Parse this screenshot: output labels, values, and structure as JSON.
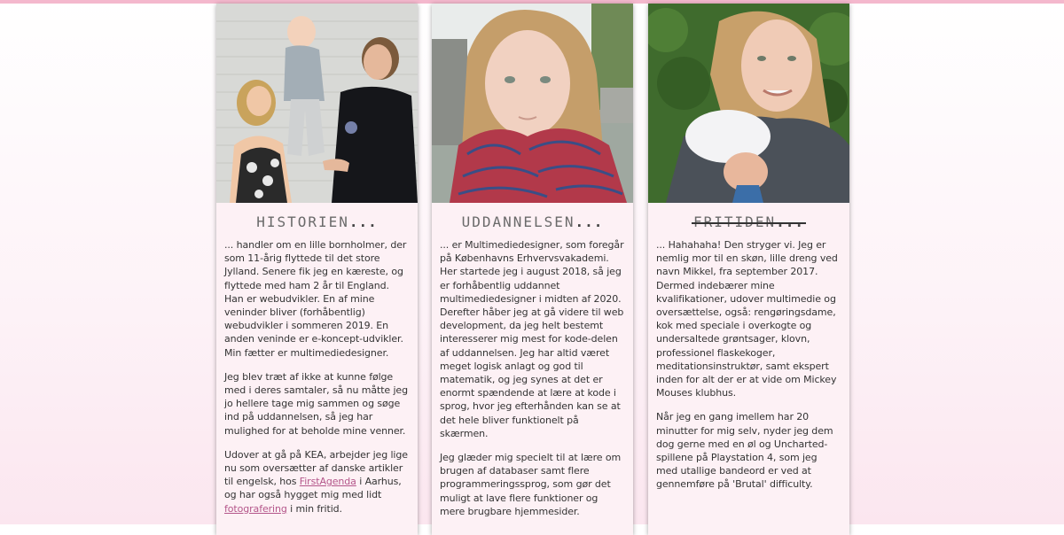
{
  "colors": {
    "accent_bar": "#f4b8cd",
    "link": "#b4568a",
    "card_bg": "#fdf1f5"
  },
  "cards": [
    {
      "photo_alt": "family-photo",
      "heading": "HISTORIEN",
      "dots": "...",
      "paragraphs": [
        "... handler om en lille bornholmer, der som 11-årig flyttede til det store Jylland. Senere fik jeg en kæreste, og flyttede med ham 2 år til England. Han er webudvikler. En af mine veninder bliver (forhåbentlig) webudvikler i sommeren 2019. En anden veninde er e-koncept-udvikler. Min fætter er multimediedesigner.",
        "Jeg blev træt af ikke at kunne følge med i deres samtaler, så nu måtte jeg jo hellere tage mig sammen og søge ind på uddannelsen, så jeg har mulighed for at beholde mine venner."
      ],
      "p3": {
        "before_link1": "Udover at gå på KEA, arbejder jeg lige nu som oversætter af danske artikler til engelsk, hos ",
        "link1": "FirstAgenda",
        "between_links": " i Aarhus, og har også hygget mig med lidt ",
        "link2": "fotografering",
        "after_link2": " i min fritid."
      }
    },
    {
      "photo_alt": "selfie-photo",
      "heading": "UDDANNELSEN",
      "dots": "...",
      "paragraphs": [
        "... er Multimediedesigner, som foregår på Københavns Erhvervsvakademi. Her startede jeg i august 2018, så jeg er forhåbentlig uddannet multimediedesigner i midten af 2020. Derefter håber jeg at gå videre til web development, da jeg helt bestemt interesserer mig mest for kode-delen af uddannelsen. Jeg har altid været meget logisk anlagt og god til matematik, og jeg synes at det er enormt spændende at lære at kode i sprog, hvor jeg efterhånden kan se at det hele bliver funktionelt på skærmen.",
        "Jeg glæder mig specielt til at lære om brugen af databaser samt flere programmeringssprog, som gør det muligt at lave flere funktioner og mere brugbare hjemmesider."
      ]
    },
    {
      "photo_alt": "mother-baby-photo",
      "heading": "FRITIDEN",
      "dots": "...",
      "paragraphs": [
        "... Hahahaha! Den stryger vi. Jeg er nemlig mor til en skøn, lille dreng ved navn Mikkel, fra september 2017. Dermed indebærer mine kvalifikationer, udover multimedie og oversættelse, også: rengøringsdame, kok med speciale i overkogte og undersaltede grøntsager, klovn, professionel flaskekoger, meditationsinstruktør, samt ekspert inden for alt der er at vide om Mickey Mouses klubhus.",
        "Når jeg en gang imellem har 20 minutter for mig selv, nyder jeg dem dog gerne med en øl og Uncharted-spillene på Playstation 4, som jeg med utallige bandeord er ved at gennemføre på 'Brutal' difficulty."
      ]
    }
  ]
}
